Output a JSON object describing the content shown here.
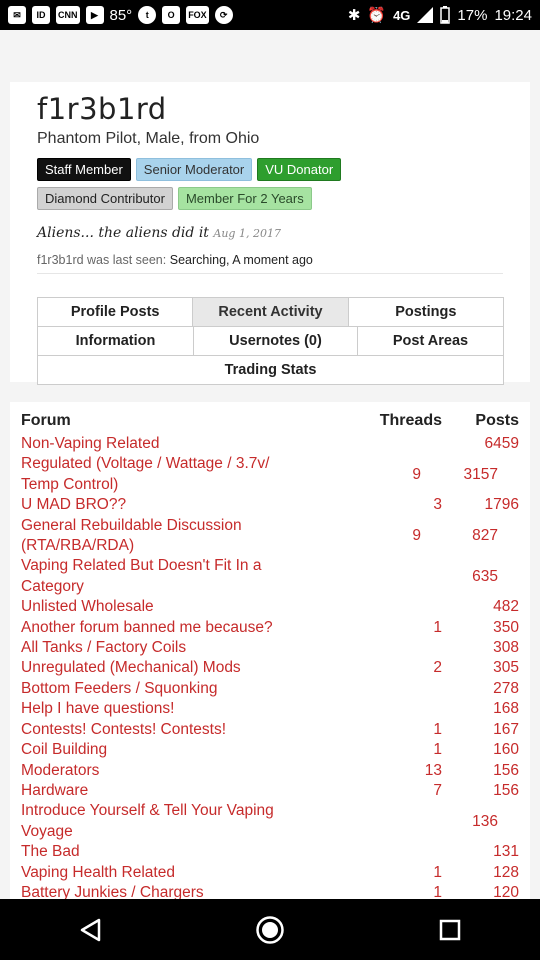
{
  "status_bar": {
    "temperature": "85°",
    "network": "4G",
    "battery": "17%",
    "time": "19:24",
    "icons": [
      "mail-icon",
      "id-icon",
      "cnn-icon",
      "youtube-icon",
      "weather-icon",
      "tumblr-icon",
      "outlook-icon",
      "fox-news-icon",
      "sync-icon",
      "bluetooth-icon",
      "alarm-icon",
      "signal-icon",
      "battery-icon"
    ]
  },
  "profile": {
    "username": "f1r3b1rd",
    "subtitle": "Phantom Pilot, Male, from Ohio",
    "badges": [
      "Staff Member",
      "Senior Moderator",
      "VU Donator",
      "Diamond Contributor",
      "Member For 2 Years"
    ],
    "status_text": "Aliens... the aliens did it",
    "status_date": "Aug 1, 2017",
    "last_seen_prefix": "f1r3b1rd was last seen:",
    "last_seen_value": "Searching, A moment ago"
  },
  "tabs": {
    "row1": [
      "Profile Posts",
      "Recent Activity",
      "Postings"
    ],
    "row2": [
      "Information",
      "Usernotes (0)",
      "Post Areas"
    ],
    "row3": [
      "Trading Stats"
    ],
    "active": "Recent Activity"
  },
  "forum_table": {
    "headers": [
      "Forum",
      "Threads",
      "Posts"
    ],
    "rows": [
      {
        "forum": "Non-Vaping Related",
        "threads": "",
        "posts": "6459"
      },
      {
        "forum": "Regulated (Voltage / Wattage / 3.7v/ Temp Control)",
        "threads": "9",
        "posts": "3157"
      },
      {
        "forum": "U MAD BRO??",
        "threads": "3",
        "posts": "1796"
      },
      {
        "forum": "General Rebuildable Discussion (RTA/RBA/RDA)",
        "threads": "9",
        "posts": "827"
      },
      {
        "forum": "Vaping Related But Doesn't Fit In a Category",
        "threads": "",
        "posts": "635"
      },
      {
        "forum": "Unlisted Wholesale",
        "threads": "",
        "posts": "482"
      },
      {
        "forum": "Another forum banned me because?",
        "threads": "1",
        "posts": "350"
      },
      {
        "forum": "All Tanks / Factory Coils",
        "threads": "",
        "posts": "308"
      },
      {
        "forum": "Unregulated (Mechanical) Mods",
        "threads": "2",
        "posts": "305"
      },
      {
        "forum": "Bottom Feeders / Squonking",
        "threads": "",
        "posts": "278"
      },
      {
        "forum": "Help I have questions!",
        "threads": "",
        "posts": "168"
      },
      {
        "forum": "Contests! Contests! Contests!",
        "threads": "1",
        "posts": "167"
      },
      {
        "forum": "Coil Building",
        "threads": "1",
        "posts": "160"
      },
      {
        "forum": "Moderators",
        "threads": "13",
        "posts": "156"
      },
      {
        "forum": "Hardware",
        "threads": "7",
        "posts": "156"
      },
      {
        "forum": "Introduce Yourself & Tell Your Vaping Voyage",
        "threads": "",
        "posts": "136"
      },
      {
        "forum": "The Bad",
        "threads": "",
        "posts": "131"
      },
      {
        "forum": "Vaping Health Related",
        "threads": "1",
        "posts": "128"
      },
      {
        "forum": "Battery Junkies / Chargers",
        "threads": "1",
        "posts": "120"
      }
    ]
  },
  "colors": {
    "link_red": "#c62b2b",
    "staff_badge": "#111111",
    "moderator_badge": "#a9d3ec",
    "donator_badge": "#2e9e2e",
    "contributor_badge": "#d2d2d2",
    "member_badge": "#a6e3a1"
  },
  "nav_bar": {
    "icons": [
      "back-icon",
      "home-icon",
      "recents-icon"
    ]
  }
}
